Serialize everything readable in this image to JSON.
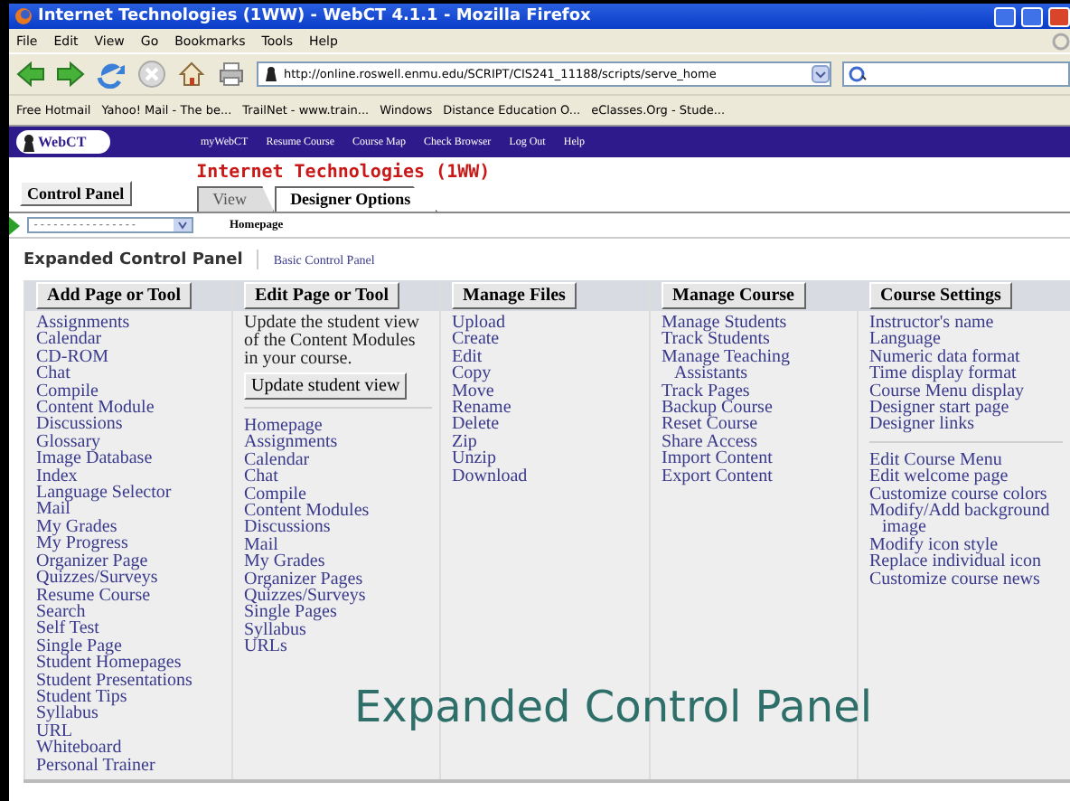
{
  "window": {
    "title": "Internet Technologies (1WW) - WebCT 4.1.1 - Mozilla Firefox"
  },
  "menu": [
    "File",
    "Edit",
    "View",
    "Go",
    "Bookmarks",
    "Tools",
    "Help"
  ],
  "toolbar": {
    "url": "http://online.roswell.enmu.edu/SCRIPT/CIS241_11188/scripts/serve_home"
  },
  "bookmarks": [
    "Free Hotmail",
    "Yahoo! Mail - The be...",
    "TrailNet - www.train...",
    "Windows",
    "Distance Education O...",
    "eClasses.Org - Stude..."
  ],
  "logo": "WebCT",
  "webct_nav": [
    "myWebCT",
    "Resume Course",
    "Course Map",
    "Check Browser",
    "Log Out",
    "Help"
  ],
  "control_panel_button": "Control Panel",
  "course_title": "Internet Technologies (1WW)",
  "tabs": [
    {
      "label": "View",
      "selected": false
    },
    {
      "label": "Designer Options",
      "selected": true
    }
  ],
  "page_select": {
    "value": "----------------"
  },
  "breadcrumb": "Homepage",
  "panel_heading": "Expanded Control Panel",
  "panel_link": "Basic Control Panel",
  "columns": [
    {
      "header": "Add Page or Tool",
      "blocks": [
        {
          "kind": "links",
          "items": [
            "Assignments",
            "Calendar",
            "CD-ROM",
            "Chat",
            "Compile",
            "Content Module",
            "Discussions",
            "Glossary",
            "Image Database",
            "Index",
            "Language Selector",
            "Mail",
            "My Grades",
            "My Progress",
            "Organizer Page",
            "Quizzes/Surveys",
            "Resume Course",
            "Search",
            "Self Test",
            "Single Page",
            "Student Homepages",
            "Student Presentations",
            "Student Tips",
            "Syllabus",
            "URL",
            "Whiteboard",
            "Personal Trainer"
          ]
        }
      ]
    },
    {
      "header": "Edit Page or Tool",
      "blocks": [
        {
          "kind": "update",
          "text": "Update the student view of the Content Modules in your course.",
          "button": "Update student view"
        },
        {
          "kind": "links",
          "items": [
            "Homepage",
            "Assignments",
            "Calendar",
            "Chat",
            "Compile",
            "Content Modules",
            "Discussions",
            "Mail",
            "My Grades",
            "Organizer Pages",
            "Quizzes/Surveys",
            "Single Pages",
            "Syllabus",
            "URLs"
          ]
        }
      ]
    },
    {
      "header": "Manage Files",
      "blocks": [
        {
          "kind": "links",
          "items": [
            "Upload",
            "Create",
            "Edit",
            "Copy",
            "Move",
            "Rename",
            "Delete",
            "Zip",
            "Unzip",
            "Download"
          ]
        }
      ]
    },
    {
      "header": "Manage Course",
      "blocks": [
        {
          "kind": "links",
          "items": [
            "Manage Students",
            "Track Students",
            "Manage Teaching Assistants",
            "Track Pages",
            "Backup Course",
            "Reset Course",
            "Share Access",
            "Import Content",
            "Export Content"
          ]
        }
      ]
    },
    {
      "header": "Course Settings",
      "blocks": [
        {
          "kind": "links",
          "items": [
            "Instructor's name",
            "Language",
            "Numeric data format",
            "Time display format",
            "Course Menu display",
            "Designer start page",
            "Designer links"
          ]
        },
        {
          "kind": "links",
          "items": [
            "Edit Course Menu",
            "Edit welcome page",
            "Customize course colors",
            "Modify/Add background image",
            "Modify icon style",
            "Replace individual icon",
            "Customize course news"
          ]
        }
      ]
    }
  ],
  "caption": "Expanded Control Panel"
}
